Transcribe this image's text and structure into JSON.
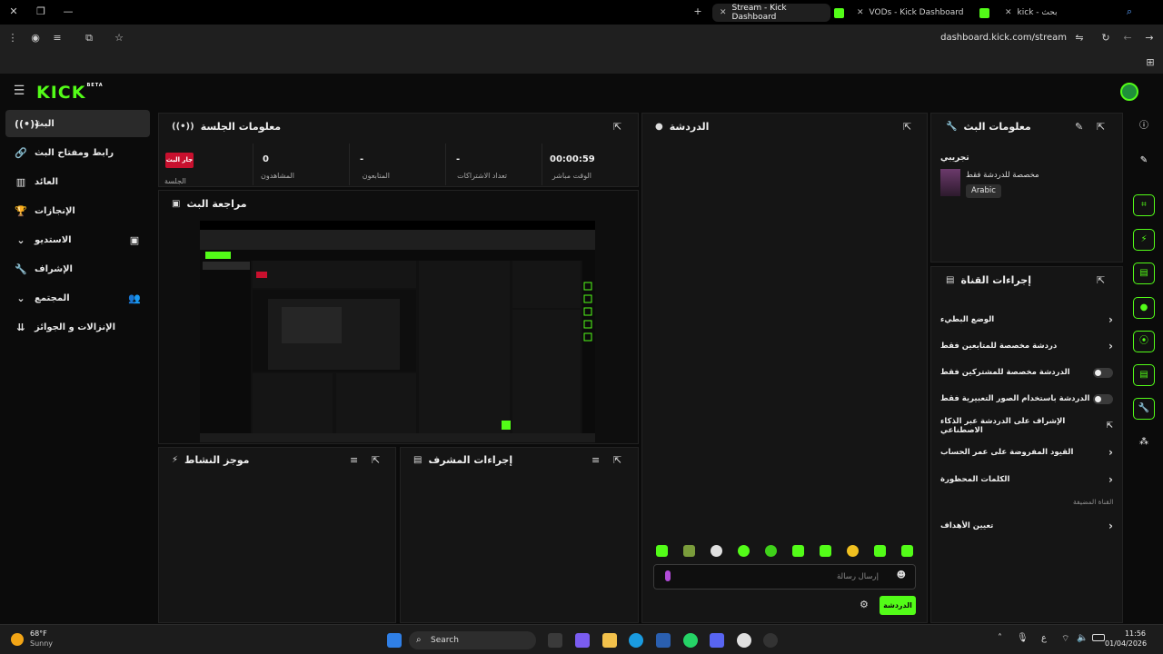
{
  "browser": {
    "tabs": [
      {
        "title": "Stream - Kick Dashboard",
        "active": true
      },
      {
        "title": "VODs - Kick Dashboard",
        "active": false
      },
      {
        "title": "kick - بحث",
        "active": false
      }
    ],
    "url": "dashboard.kick.com/stream"
  },
  "header": {
    "logo": "KICK",
    "logo_tag": "BETA"
  },
  "sidebar": {
    "items": [
      {
        "label": "البث",
        "icon": "broadcast-icon",
        "glyph": "((•))"
      },
      {
        "label": "رابط ومفتاح البث",
        "icon": "link-icon",
        "glyph": "🔗"
      },
      {
        "label": "العائد",
        "icon": "revenue-icon",
        "glyph": "▥"
      },
      {
        "label": "الإنجازات",
        "icon": "trophy-icon",
        "glyph": "🏆"
      },
      {
        "label": "الاستديو",
        "icon": "studio-icon",
        "glyph": "▣"
      },
      {
        "label": "الإشراف",
        "icon": "moderation-icon",
        "glyph": "🔧"
      },
      {
        "label": "المجتمع",
        "icon": "community-icon",
        "glyph": "👥"
      },
      {
        "label": "الإنزالات و الجوائز",
        "icon": "drops-icon",
        "glyph": "⇊"
      }
    ]
  },
  "session": {
    "title": "معلومات الجلسة",
    "live_badge": "جار البث",
    "session_label": "الجلسة",
    "stats": [
      {
        "label": "الوقت مباشر",
        "value": "00:00:59"
      },
      {
        "label": "تعداد الاشتراكات",
        "value": "-"
      },
      {
        "label": "المتابعون",
        "value": "-"
      },
      {
        "label": "المشاهدون",
        "value": "0"
      }
    ]
  },
  "preview": {
    "title": "مراجعة البث"
  },
  "activity": {
    "title": "موجز النشاط"
  },
  "moderator": {
    "title": "إجراءات المشرف"
  },
  "chat": {
    "title": "الدردشة",
    "placeholder": "إرسال رسالة",
    "send_label": "الدردشة"
  },
  "stream_info": {
    "title": "معلومات البث",
    "stream_title": "تجريبي",
    "category": "مخصصة للدردشة فقط",
    "language": "Arabic"
  },
  "channel_actions": {
    "title": "إجراءات القناة",
    "items": [
      {
        "label": "الوضع البطيء",
        "control": "chevron"
      },
      {
        "label": "دردشة مخصصة للمتابعين فقط",
        "control": "chevron"
      },
      {
        "label": "الدردشة مخصصة للمشتركين فقط",
        "control": "toggle"
      },
      {
        "label": "الدردشة باستخدام الصور التعبيرية فقط",
        "control": "toggle"
      },
      {
        "label": "الإشراف على الدردشة عبر الذكاء الاصطناعي",
        "control": "external"
      },
      {
        "label": "القيود المفروضة على عمر الحساب",
        "control": "chevron"
      },
      {
        "label": "الكلمات المحظورة",
        "control": "chevron"
      }
    ],
    "section_label": "القناة المضيفة",
    "goals_label": "تعيين الأهداف"
  },
  "taskbar": {
    "weather_temp": "68°F",
    "weather_text": "Sunny",
    "search": "Search",
    "time": "11:56",
    "date": "01/04/2026",
    "lang": "ع"
  },
  "colors": {
    "accent": "#53fc18",
    "live": "#c8102e",
    "panel": "#151515",
    "background": "#0b0b0b"
  }
}
